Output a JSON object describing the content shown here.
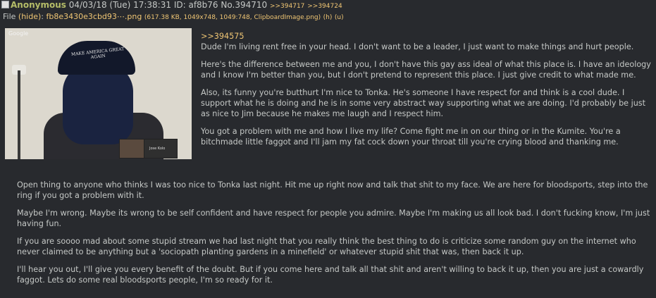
{
  "header": {
    "name": "Anonymous",
    "datetime": "04/03/18 (Tue) 17:38:31",
    "id_label": "ID:",
    "id": "af8b76",
    "no": "No.394710",
    "backlinks": [
      ">>394717",
      ">>394724"
    ]
  },
  "file": {
    "label": "File",
    "hide": "(hide)",
    "name": "fb8e3430e3cbd93⋯.png",
    "meta": "(617.38 KB, 1049x748, 1049:748, ClipboardImage.png)",
    "h": "(h)",
    "u": "(u)"
  },
  "thumbnail": {
    "corner_label": "Google",
    "cap_text": "MAKE AMERICA GREAT AGAIN",
    "participant_name": "Jose Kolo"
  },
  "post": {
    "quotelink": ">>394575",
    "side_paragraphs": [
      "Dude I'm living rent free in your head. I don't want to be a leader, I just want to make things and hurt people.",
      "Here's the difference between me and you, I don't have this gay ass ideal of what this place is. I have an ideology and I know I'm better than you, but I don't pretend to represent this place. I just give credit to what made me.",
      "Also, its funny you're butthurt I'm nice to Tonka. He's someone I have respect for and think is a cool dude. I support what he is doing and he is in some very abstract way supporting what we are doing. I'd probably be just as nice to Jim because he makes me laugh and I respect him.",
      "You got a problem with me and how I live my life? Come fight me in on our thing or in the Kumite. You're a bitchmade little faggot and I'll jam my fat cock down your throat till you're crying blood and thanking me."
    ],
    "full_paragraphs": [
      "Open thing to anyone who thinks I was too nice to Tonka last night. Hit me up right now and talk that shit to my face. We are here for bloodsports, step into the ring if you got a problem with it.",
      "Maybe I'm wrong. Maybe its wrong to be self confident and have respect for people you admire. Maybe I'm making us all look bad. I don't fucking know, I'm just having fun.",
      "If you are soooo mad about some stupid stream we had last night that you really think the best thing to do is criticize some random guy on the internet who never claimed to be anything but a 'sociopath planting gardens in a minefield' or whatever stupid shit that was, then back it up.",
      "I'll hear you out, I'll give you every benefit of the doubt. But if you come here and talk all that shit and aren't willing to back it up, then you are just a cowardly faggot. Lets do some real bloodsports people, I'm so ready for it."
    ]
  },
  "colors": {
    "background": "#282a2e",
    "text": "#c5c8c6",
    "name": "#b5bd68",
    "link": "#f0c674"
  }
}
